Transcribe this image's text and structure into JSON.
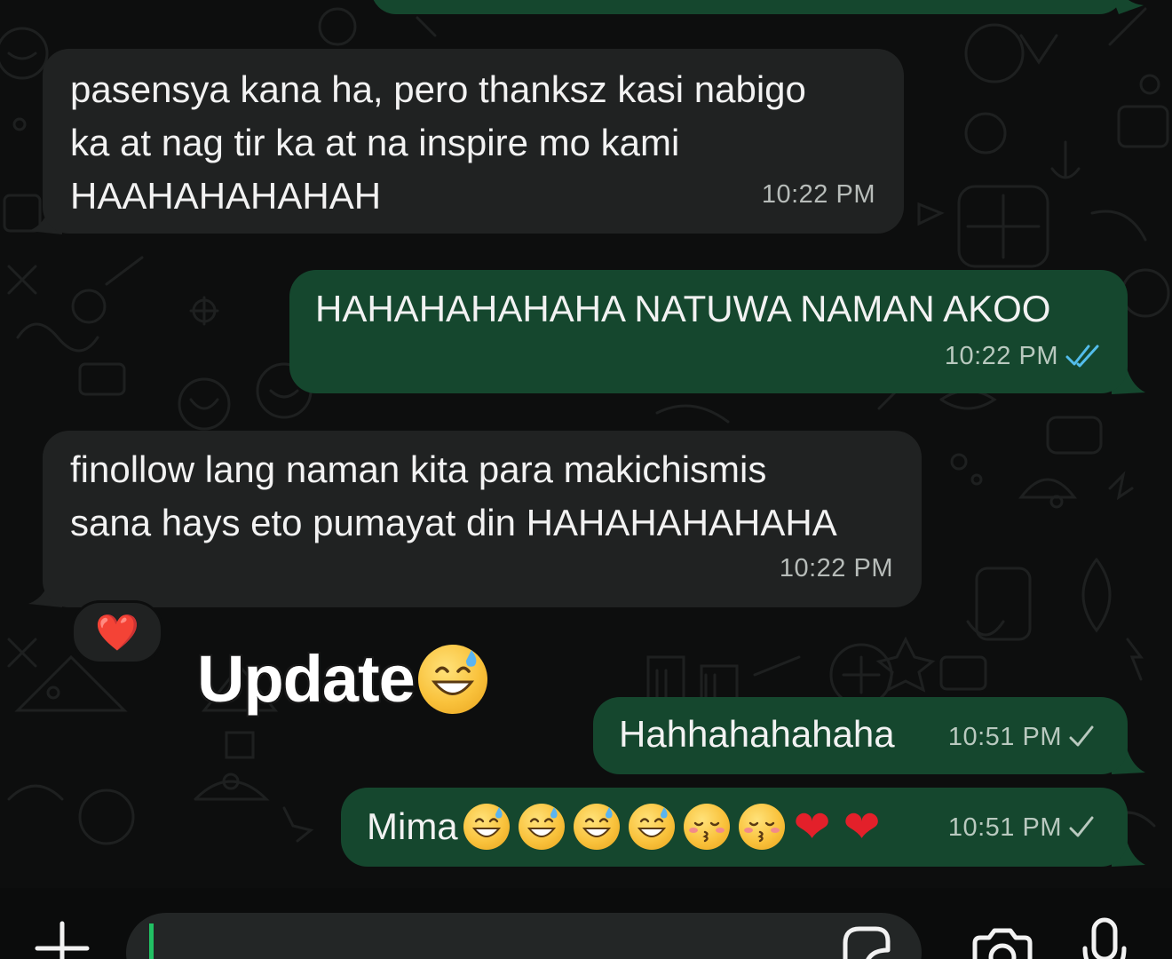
{
  "messages": [
    {
      "id": "m0",
      "direction": "outgoing",
      "text": "",
      "partial": true
    },
    {
      "id": "m1",
      "direction": "incoming",
      "text": "pasensya kana ha, pero thanksz kasi nabigo\nka at nag tir ka at na inspire mo kami\nHAAHAHAHAHAH",
      "time": "10:22 PM"
    },
    {
      "id": "m2",
      "direction": "outgoing",
      "text": "HAHAHAHAHAHA NATUWA NAMAN AKOO",
      "time": "10:22 PM",
      "status": "read",
      "status_icon": "double-check-icon"
    },
    {
      "id": "m3",
      "direction": "incoming",
      "text": "finollow lang naman kita para makichismis\nsana hays eto pumayat din HAHAHAHAHAHA",
      "time": "10:22 PM",
      "reaction": "❤️"
    },
    {
      "id": "m4",
      "direction": "outgoing",
      "text": "Hahhahahahaha",
      "time": "10:51 PM",
      "status": "sent",
      "status_icon": "single-check-icon"
    },
    {
      "id": "m5",
      "direction": "outgoing",
      "text": "Mima",
      "emojis": [
        "grinning-sweat",
        "grinning-sweat",
        "grinning-sweat",
        "grinning-sweat",
        "kissing-closed-eyes",
        "kissing-closed-eyes",
        "red-heart",
        "red-heart"
      ],
      "time": "10:51 PM",
      "status": "sent",
      "status_icon": "single-check-icon"
    }
  ],
  "overlay": {
    "sticker_text": "Update",
    "sticker_emoji": "grinning-sweat"
  },
  "composer": {
    "message_value": "",
    "icons": [
      "plus-icon",
      "sticker-icon",
      "camera-icon",
      "microphone-icon"
    ]
  },
  "colors": {
    "incoming_bubble": "#202222",
    "outgoing_bubble": "#15472e",
    "read_tick": "#53bdeb",
    "background": "#0d0e0e",
    "accent": "#21c063"
  }
}
